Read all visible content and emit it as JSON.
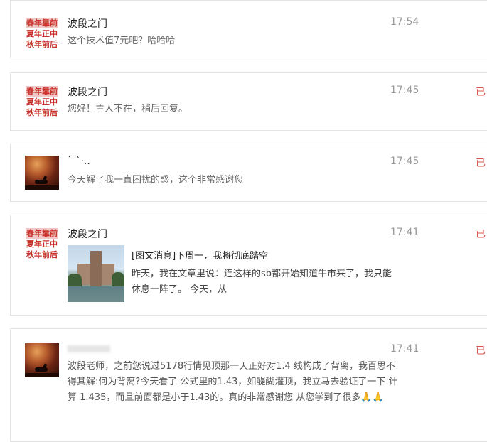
{
  "messages": [
    {
      "avatar_type": "text",
      "avatar_lines": [
        "春年靠前",
        "夏年正中",
        "秋年前后"
      ],
      "name": "波段之门",
      "time": "17:54",
      "reply": "",
      "text": "这个技术值7元吧？哈哈哈"
    },
    {
      "avatar_type": "text",
      "avatar_lines": [
        "春年靠前",
        "夏年正中",
        "秋年前后"
      ],
      "name": "波段之门",
      "time": "17:45",
      "reply": "已",
      "text": "您好！主人不在，稍后回复。"
    },
    {
      "avatar_type": "image",
      "name": "` `·..",
      "time": "17:45",
      "reply": "已",
      "text": "今天解了我一直困扰的惑，这个非常感谢您"
    },
    {
      "avatar_type": "text",
      "avatar_lines": [
        "春年靠前",
        "夏年正中",
        "秋年前后"
      ],
      "name": "波段之门",
      "time": "17:41",
      "reply": "已",
      "article_title": "[图文消息]下周一，我将彻底踏空",
      "article_body": "昨天，我在文章里说：连这样的sb都开始知道牛市来了，我只能休息一阵了。 今天，从"
    },
    {
      "avatar_type": "image",
      "name": "",
      "time": "17:41",
      "reply": "已",
      "text": "波段老师，之前您说过5178行情见顶那一天正好对1.4 线构成了背离，我百思不得其解:何为背离?今天看了 公式里的1.43，如醍醐灌顶，我立马去验证了一下  计算 1.435，而且前面都是小于1.43的。真的非常感谢您 从您学到了很多🙏🙏"
    }
  ]
}
